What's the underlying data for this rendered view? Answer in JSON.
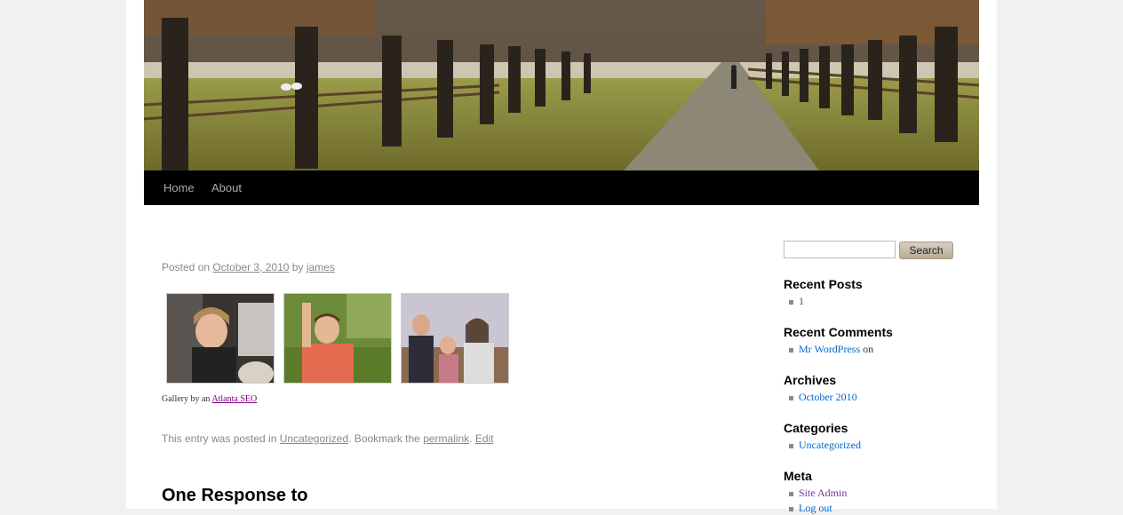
{
  "nav": {
    "home": "Home",
    "about": "About"
  },
  "post": {
    "posted_on": "Posted on",
    "date": "October 3, 2010",
    "by": "by",
    "author": "james",
    "gallery_caption_prefix": "Gallery by an",
    "gallery_caption_link": "Atlanta SEO",
    "footer_prefix": "This entry was posted in",
    "category": "Uncategorized",
    "bookmark_text": ". Bookmark the",
    "permalink": "permalink",
    "separator": ".",
    "edit": "Edit",
    "responses_heading": "One Response to"
  },
  "sidebar": {
    "search_placeholder": "",
    "search_button": "Search",
    "recent_posts": {
      "title": "Recent Posts",
      "items": [
        "1"
      ]
    },
    "recent_comments": {
      "title": "Recent Comments",
      "author": "Mr WordPress",
      "on": "on"
    },
    "archives": {
      "title": "Archives",
      "items": [
        "October 2010"
      ]
    },
    "categories": {
      "title": "Categories",
      "items": [
        "Uncategorized"
      ]
    },
    "meta": {
      "title": "Meta",
      "items": [
        "Site Admin",
        "Log out"
      ]
    }
  },
  "colors": {
    "nav_bg": "#000000",
    "link_blue": "#0066cc",
    "link_purple": "#743399",
    "page_bg": "#f1f1f1"
  }
}
